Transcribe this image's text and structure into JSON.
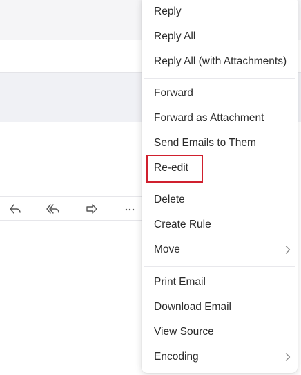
{
  "toolbar": {
    "icons": [
      "reply-icon",
      "reply-all-icon",
      "forward-icon",
      "more-icon"
    ]
  },
  "menu": {
    "items": [
      {
        "label": "Reply"
      },
      {
        "label": "Reply All"
      },
      {
        "label": "Reply All (with Attachments)"
      },
      {
        "label": "Forward"
      },
      {
        "label": "Forward as Attachment"
      },
      {
        "label": "Send Emails to Them"
      },
      {
        "label": "Re-edit"
      },
      {
        "label": "Delete"
      },
      {
        "label": "Create Rule"
      },
      {
        "label": "Move",
        "submenu": true
      },
      {
        "label": "Print Email"
      },
      {
        "label": "Download Email"
      },
      {
        "label": "View Source"
      },
      {
        "label": "Encoding",
        "submenu": true
      }
    ],
    "highlighted_item": "Re-edit"
  },
  "colors": {
    "highlight_border": "#d0202e",
    "menu_text": "#2b2b2b",
    "icon": "#555555"
  }
}
